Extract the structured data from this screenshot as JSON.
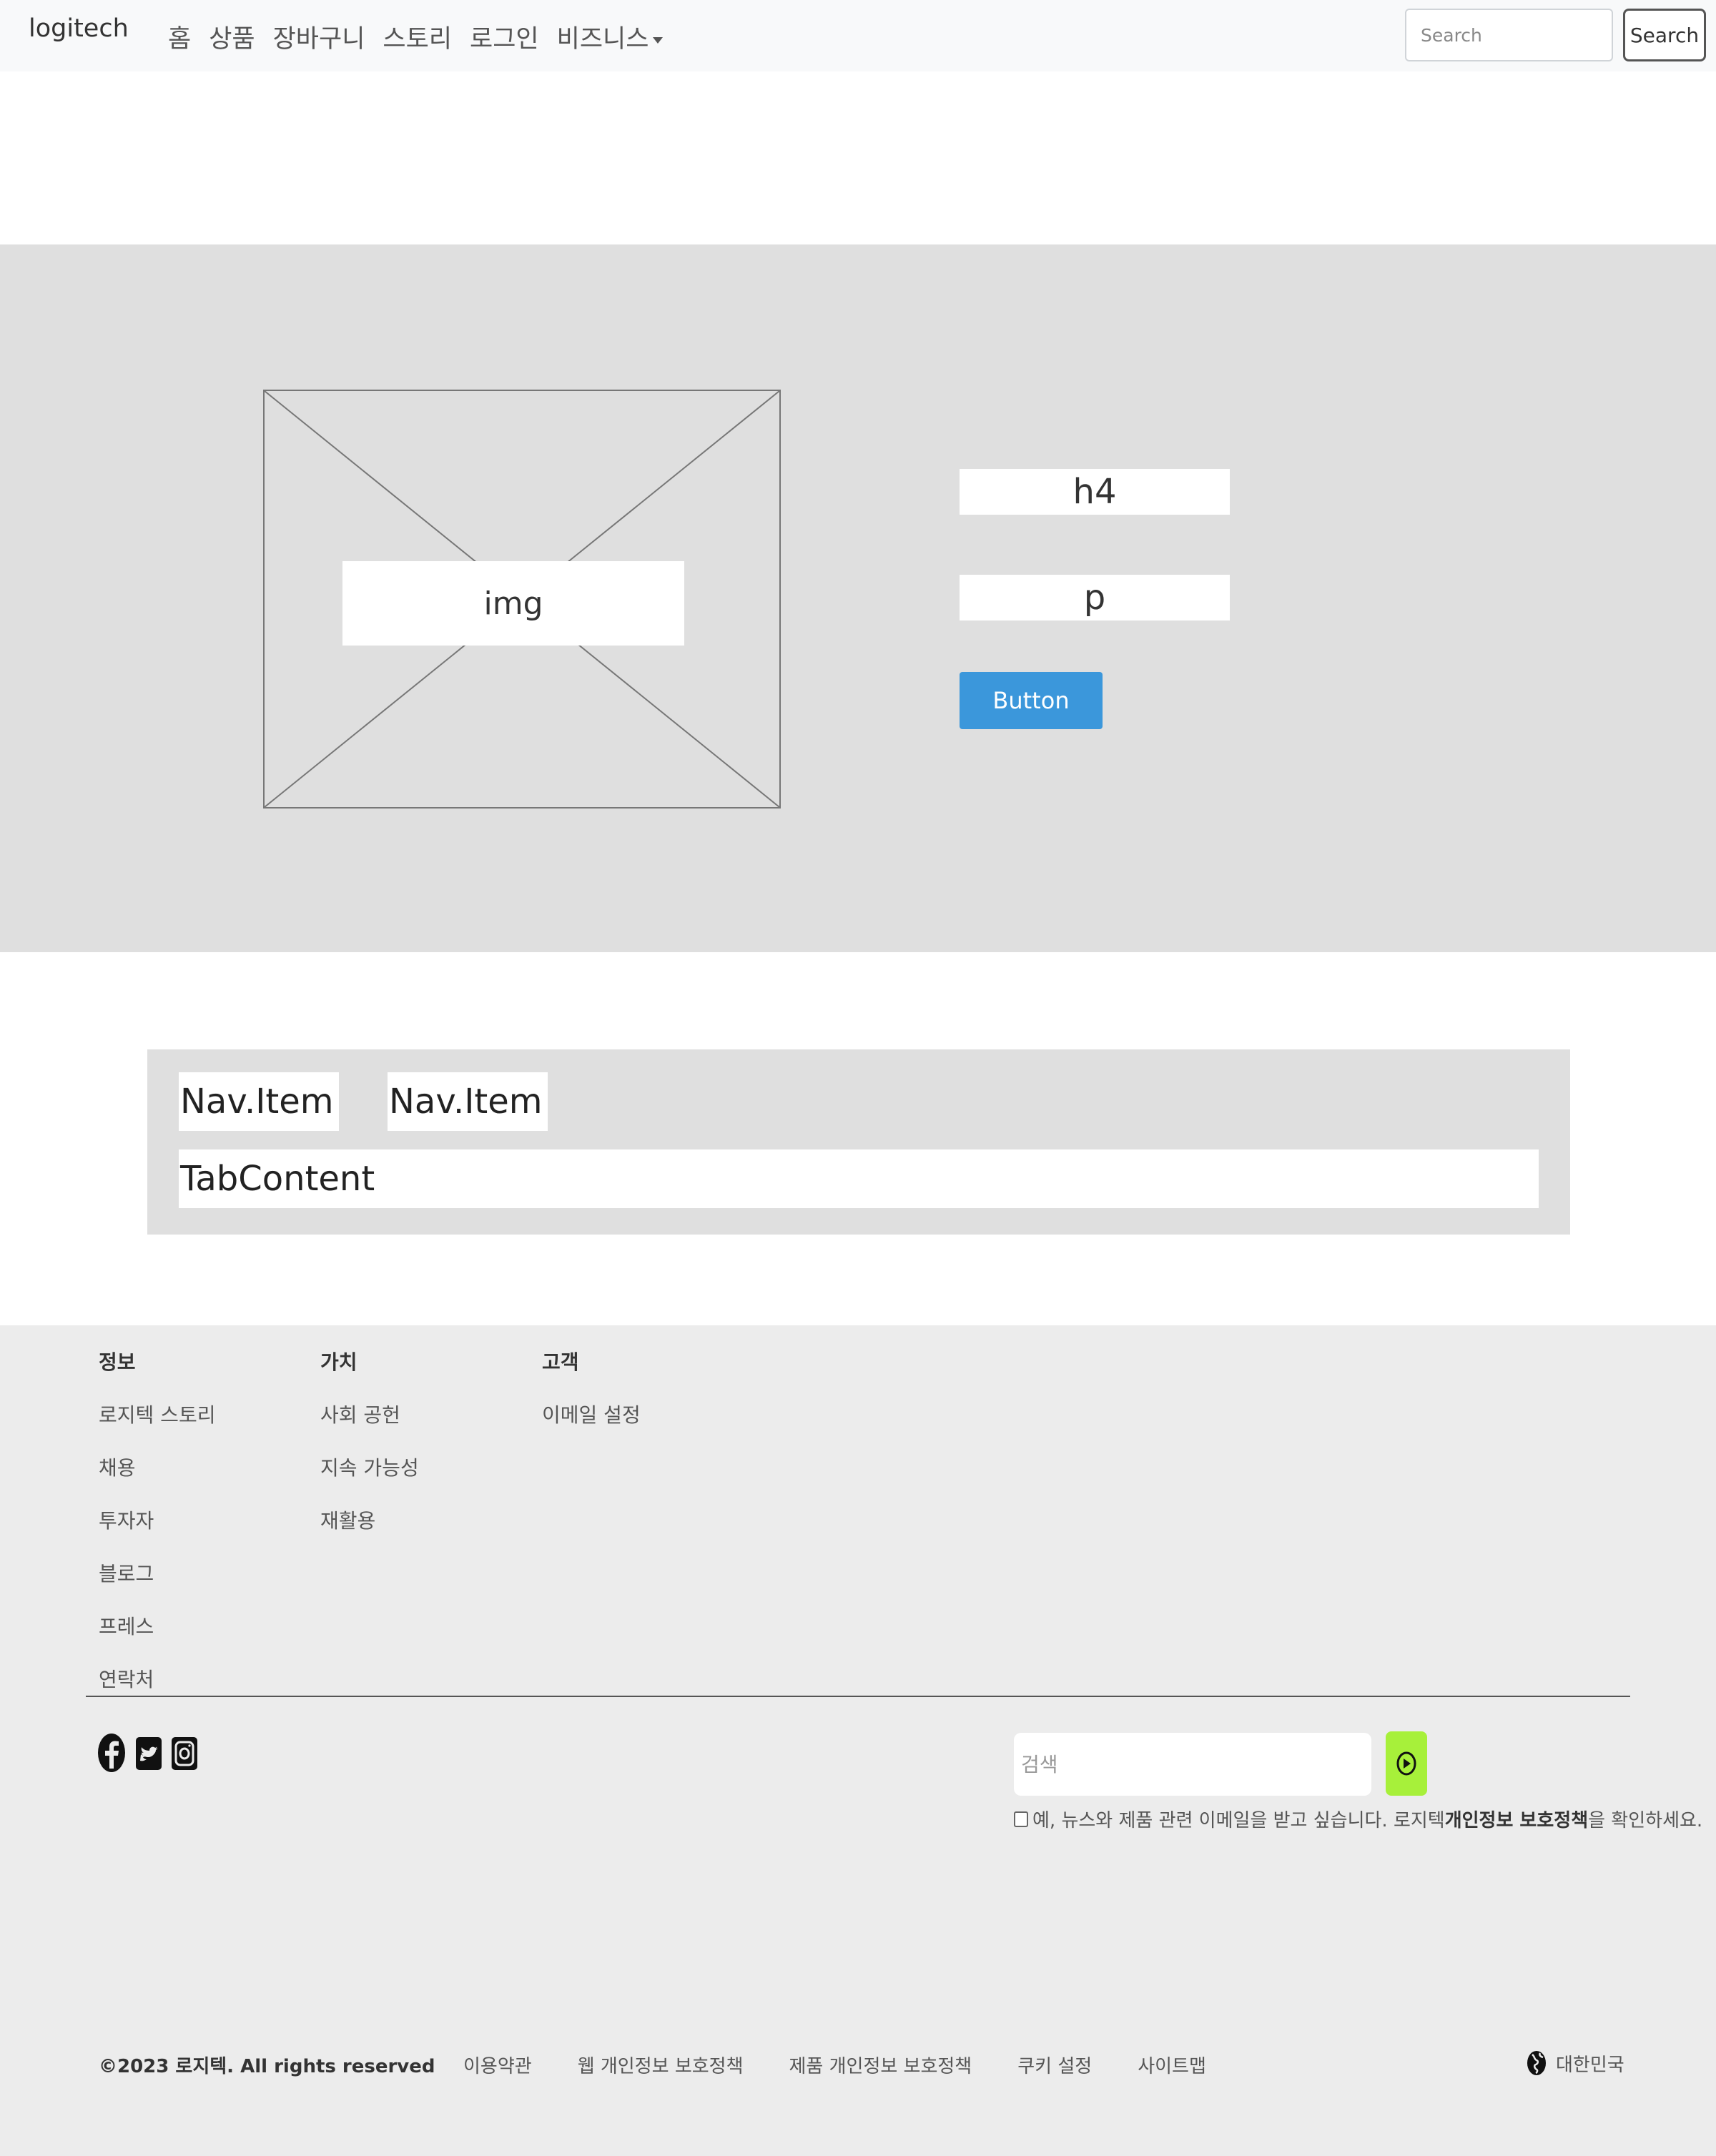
{
  "navbar": {
    "brand": "logitech",
    "links": [
      "홈",
      "상품",
      "장바구니",
      "스토리",
      "로그인",
      "비즈니스"
    ],
    "search_placeholder": "Search",
    "search_button": "Search"
  },
  "hero": {
    "image_label": "img",
    "heading": "h4",
    "paragraph": "p",
    "button": "Button"
  },
  "tabs": {
    "items": [
      "Nav.Item",
      "Nav.Item"
    ],
    "content": "TabContent"
  },
  "footer": {
    "columns": [
      {
        "heading": "정보",
        "items": [
          "로지텍 스토리",
          "채용",
          "투자자",
          "블로그",
          "프레스",
          "연락처"
        ]
      },
      {
        "heading": "가치",
        "items": [
          "사회 공헌",
          "지속 가능성",
          "재활용"
        ]
      },
      {
        "heading": "고객",
        "items": [
          "이메일 설정"
        ]
      }
    ],
    "social": [
      "facebook-icon",
      "twitter-icon",
      "instagram-icon"
    ],
    "newsletter": {
      "placeholder": "검색",
      "consent_prefix": "예, 뉴스와 제품 관련 이메일을 받고 싶습니다. 로지텍 ",
      "consent_link": "개인정보 보호정책",
      "consent_suffix": "을 확인하세요."
    },
    "copyright": "©2023 로지텍. All rights reserved",
    "legal_links": [
      "이용약관",
      "웹 개인정보 보호정책",
      "제품 개인정보 보호정책",
      "쿠키 설정",
      "사이트맵"
    ],
    "region": "대한민국",
    "accent_color": "#a7f03a"
  },
  "colors": {
    "button_primary": "#3b97db",
    "section_bg": "#dfdfdf",
    "footer_bg": "#ececec"
  }
}
